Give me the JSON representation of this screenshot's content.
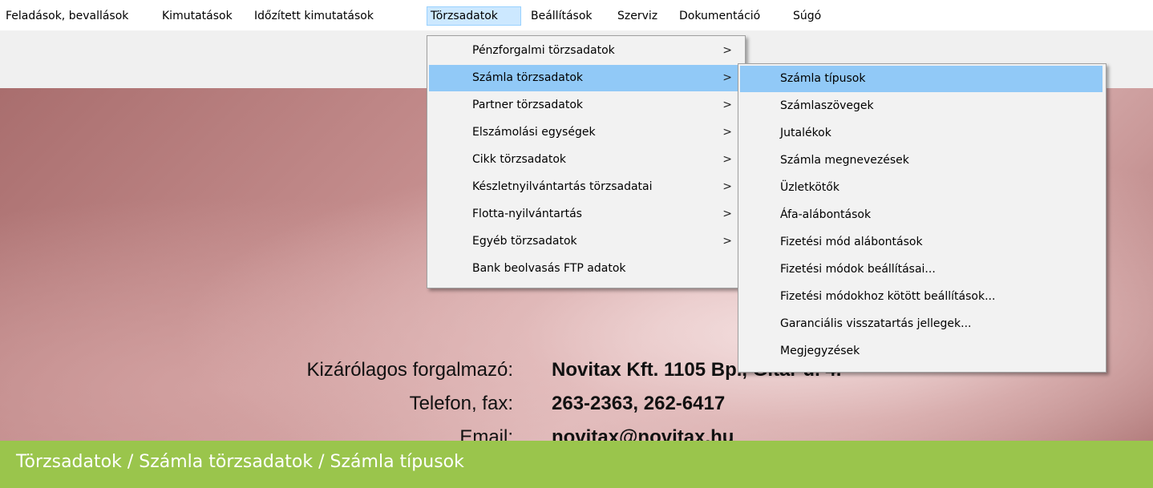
{
  "menubar": {
    "items": [
      {
        "label": "Feladások, bevallások"
      },
      {
        "label": "Kimutatások"
      },
      {
        "label": "Időzített kimutatások"
      },
      {
        "label": "Törzsadatok"
      },
      {
        "label": "Beállítások"
      },
      {
        "label": "Szerviz"
      },
      {
        "label": "Dokumentáció"
      },
      {
        "label": "Súgó"
      }
    ]
  },
  "torzsadatok_menu": {
    "items": [
      {
        "label": "Pénzforgalmi törzsadatok",
        "arrow": ">"
      },
      {
        "label": "Számla törzsadatok",
        "arrow": ">"
      },
      {
        "label": "Partner törzsadatok",
        "arrow": ">"
      },
      {
        "label": "Elszámolási egységek",
        "arrow": ">"
      },
      {
        "label": "Cikk törzsadatok",
        "arrow": ">"
      },
      {
        "label": "Készletnyilvántartás törzsadatai",
        "arrow": ">"
      },
      {
        "label": "Flotta-nyilvántartás",
        "arrow": ">"
      },
      {
        "label": "Egyéb törzsadatok",
        "arrow": ">"
      },
      {
        "label": "Bank beolvasás FTP adatok",
        "arrow": ""
      }
    ]
  },
  "szamla_submenu": {
    "items": [
      {
        "label": "Számla típusok"
      },
      {
        "label": "Számlaszövegek"
      },
      {
        "label": "Jutalékok"
      },
      {
        "label": "Számla megnevezések"
      },
      {
        "label": "Üzletkötők"
      },
      {
        "label": "Áfa-alábontások"
      },
      {
        "label": "Fizetési mód alábontások"
      },
      {
        "label": "Fizetési módok beállításai..."
      },
      {
        "label": "Fizetési módokhoz kötött beállítások..."
      },
      {
        "label": "Garanciális visszatartás jellegek..."
      },
      {
        "label": "Megjegyzések"
      }
    ]
  },
  "info": {
    "distributor_label": "Kizárólagos forgalmazó:",
    "distributor_value": "Novitax Kft.    1105 Bp., Gitár u. 4.",
    "phone_label": "Telefon, fax:",
    "phone_value": "263-2363, 262-6417",
    "email_label": "Email:",
    "email_value": "novitax@novitax.hu"
  },
  "breadcrumb": {
    "text": "Törzsadatok / Számla törzsadatok / Számla típusok"
  },
  "colors": {
    "menu_highlight": "#91c9f7",
    "breadcrumb_bg": "#9ac54c"
  }
}
